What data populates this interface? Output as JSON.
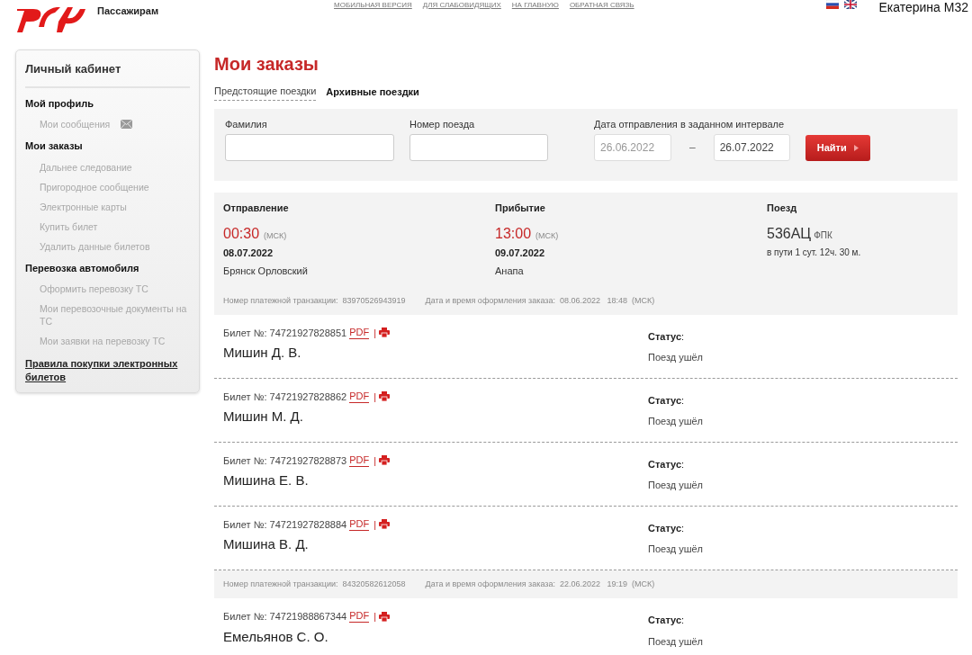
{
  "header": {
    "section": "Пассажирам",
    "top_links": [
      "МОБИЛЬНАЯ ВЕРСИЯ",
      "ДЛЯ СЛАБОВИДЯЩИХ",
      "НА ГЛАВНУЮ",
      "ОБРАТНАЯ СВЯЗЬ"
    ],
    "user": "Екатерина М32"
  },
  "sidebar": {
    "title": "Личный кабинет",
    "groups": [
      {
        "label": "Мой профиль",
        "items": [
          {
            "label": "Мои сообщения",
            "kind": "mail"
          }
        ]
      },
      {
        "label": "Мои заказы",
        "items": [
          {
            "label": "Дальнее следование",
            "kind": "plain"
          },
          {
            "label": "Пригородное сообщение",
            "kind": "plain"
          },
          {
            "label": "Электронные карты",
            "kind": "plain"
          },
          {
            "label": "Купить билет",
            "kind": "plain"
          },
          {
            "label": "Удалить данные билетов",
            "kind": "plain"
          }
        ]
      },
      {
        "label": "Перевозка автомобиля",
        "items": [
          {
            "label": "Оформить перевозку ТС",
            "kind": "plain"
          },
          {
            "label": "Мои перевозочные документы на ТС",
            "kind": "plain"
          },
          {
            "label": "Мои заявки на перевозку ТС",
            "kind": "plain"
          }
        ]
      }
    ],
    "rules_link": "Правила покупки электронных билетов"
  },
  "page_title": "Мои заказы",
  "tabs": [
    {
      "label": "Предстоящие поездки",
      "selected": false
    },
    {
      "label": "Архивные поездки",
      "selected": true
    }
  ],
  "filter": {
    "surname_label": "Фамилия",
    "train_label": "Номер поезда",
    "date_label": "Дата отправления в заданном интервале",
    "date_from": "26.06.2022",
    "dash": "–",
    "date_to": "26.07.2022",
    "button": "Найти"
  },
  "orders": [
    {
      "trip": {
        "departure_label": "Отправление",
        "departure_time": "00:30",
        "departure_tz": "(МСК)",
        "departure_date": "08.07.2022",
        "departure_station": "Брянск Орловский",
        "arrival_label": "Прибытие",
        "arrival_time": "13:00",
        "arrival_tz": "(МСК)",
        "arrival_date": "09.07.2022",
        "arrival_station": "Анапа",
        "train_label": "Поезд",
        "train": "536АЦ",
        "carrier": "ФПК",
        "duration": "в пути 1 сут. 12ч. 30 м."
      },
      "transaction_label": "Номер платежной транзакции:",
      "transaction": "83970526943919",
      "ordered_label": "Дата и время оформления заказа:",
      "ordered_date": "08.06.2022",
      "ordered_time": "18:48",
      "ordered_tz": "(МСК)",
      "tickets": [
        {
          "label": "Билет №:",
          "number": "74721927828851",
          "pdf": "PDF",
          "sep": "|",
          "name": "Мишин Д. В.",
          "status_label": "**Статус**:",
          "status": "Поезд ушёл"
        },
        {
          "label": "Билет №:",
          "number": "74721927828862",
          "pdf": "PDF",
          "sep": "|",
          "name": "Мишин М. Д.",
          "status_label": "**Статус**:",
          "status": "Поезд ушёл"
        },
        {
          "label": "Билет №:",
          "number": "74721927828873",
          "pdf": "PDF",
          "sep": "|",
          "name": "Мишина Е. В.",
          "status_label": "**Статус**:",
          "status": "Поезд ушёл"
        },
        {
          "label": "Билет №:",
          "number": "74721927828884",
          "pdf": "PDF",
          "sep": "|",
          "name": "Мишина В. Д.",
          "status_label": "**Статус**:",
          "status": "Поезд ушёл"
        }
      ]
    },
    {
      "transaction_label": "Номер платежной транзакции:",
      "transaction": "84320582612058",
      "ordered_label": "Дата и время оформления заказа:",
      "ordered_date": "22.06.2022",
      "ordered_time": "19:19",
      "ordered_tz": "(МСК)",
      "tickets": [
        {
          "label": "Билет №:",
          "number": "74721988867344",
          "pdf": "PDF",
          "sep": "|",
          "name": "Емельянов С. О.",
          "status_label": "**Статус**:",
          "status": "Поезд ушёл"
        }
      ]
    }
  ]
}
